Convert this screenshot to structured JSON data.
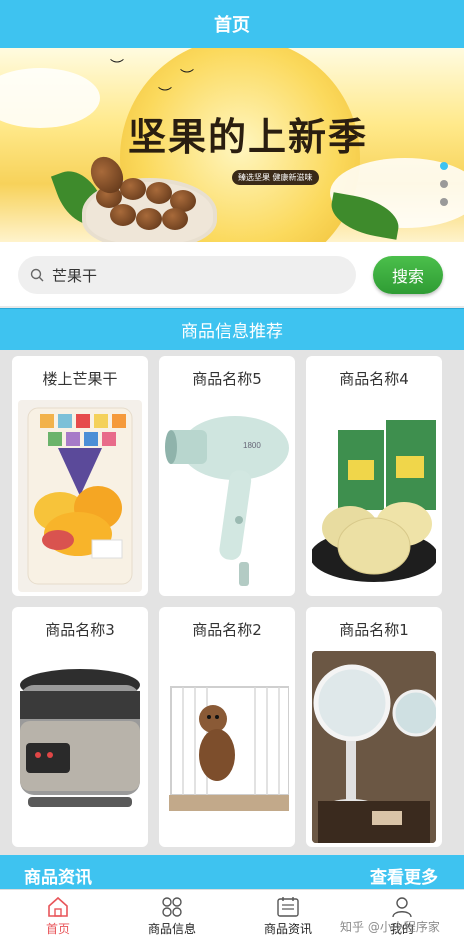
{
  "header": {
    "title": "首页"
  },
  "banner": {
    "title": "坚果的上新季",
    "badge": "臻选坚果 健康新滋味",
    "slide_count": 3,
    "active_slide": 1
  },
  "search": {
    "value": "芒果干",
    "button_label": "搜索"
  },
  "recommend": {
    "title": "商品信息推荐"
  },
  "products": [
    {
      "name": "楼上芒果干",
      "image": "dried-mango-bag"
    },
    {
      "name": "商品名称5",
      "image": "hair-dryer"
    },
    {
      "name": "商品名称4",
      "image": "mooncakes"
    },
    {
      "name": "商品名称3",
      "image": "rice-cooker"
    },
    {
      "name": "商品名称2",
      "image": "dog-cage"
    },
    {
      "name": "商品名称1",
      "image": "vanity-mirror"
    }
  ],
  "news": {
    "title": "商品资讯",
    "more_label": "查看更多"
  },
  "tabbar": {
    "items": [
      {
        "label": "首页",
        "icon": "home-icon",
        "active": true
      },
      {
        "label": "商品信息",
        "icon": "grid-icon",
        "active": false
      },
      {
        "label": "商品资讯",
        "icon": "news-icon",
        "active": false
      },
      {
        "label": "我的",
        "icon": "user-icon",
        "active": false
      }
    ]
  },
  "watermark": "知乎 @小小程序家",
  "colors": {
    "primary": "#3ec3f0",
    "search_button": "#34a83a",
    "tab_active": "#e8555a"
  }
}
